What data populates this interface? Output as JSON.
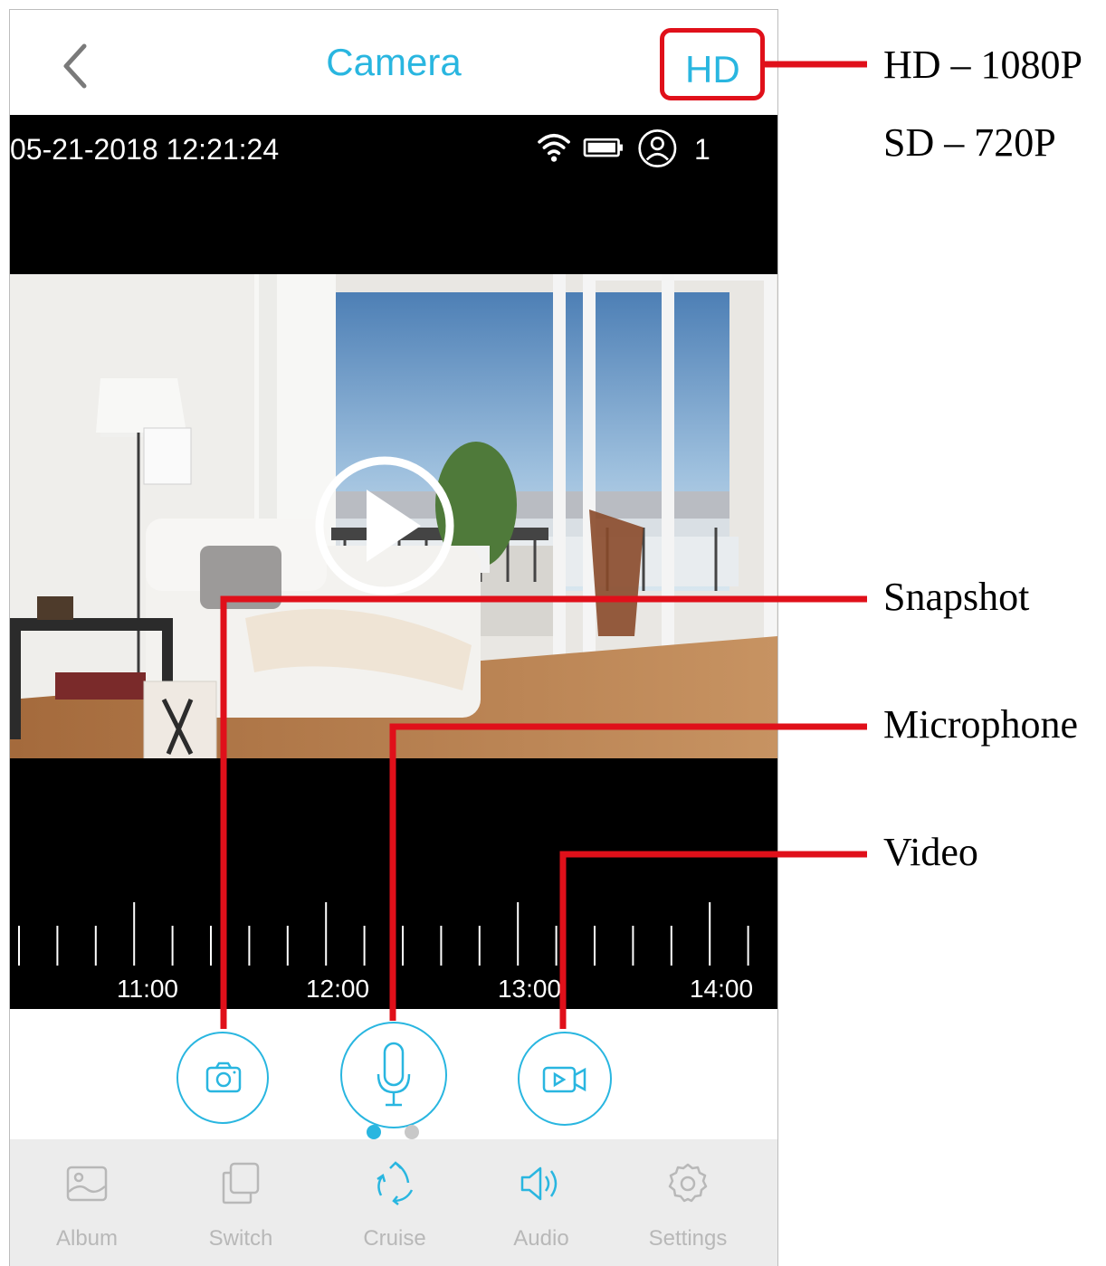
{
  "header": {
    "title": "Camera",
    "quality_label": "HD"
  },
  "status_bar": {
    "datetime": "05-21-2018 12:21:24",
    "viewer_count": "1"
  },
  "timeline": {
    "labels": [
      "11:00",
      "12:00",
      "13:00",
      "14:00"
    ]
  },
  "controls": {
    "snapshot": "camera-icon",
    "microphone": "microphone-icon",
    "video": "video-record-icon"
  },
  "pager": {
    "pages": 2,
    "active": 0
  },
  "tabs": [
    {
      "label": "Album",
      "icon": "album-icon"
    },
    {
      "label": "Switch",
      "icon": "switch-icon"
    },
    {
      "label": "Cruise",
      "icon": "cruise-icon"
    },
    {
      "label": "Audio",
      "icon": "audio-icon"
    },
    {
      "label": "Settings",
      "icon": "settings-icon"
    }
  ],
  "callouts": {
    "hd": "HD – 1080P",
    "sd": "SD – 720P",
    "snapshot": "Snapshot",
    "microphone": "Microphone",
    "video": "Video"
  },
  "colors": {
    "accent": "#29b6e0",
    "annotation": "#e0101a"
  }
}
